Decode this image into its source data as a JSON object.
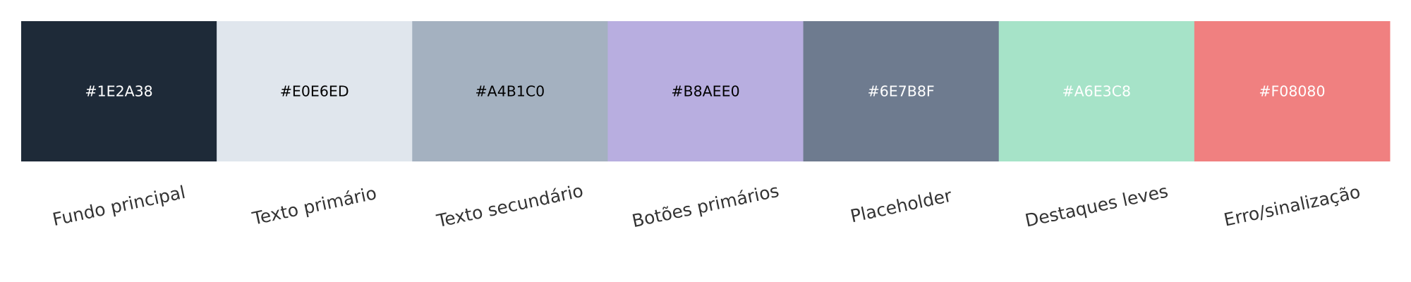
{
  "chart_data": {
    "type": "palette",
    "swatches": [
      {
        "hex": "#1E2A38",
        "label": "Fundo principal",
        "text_color": "#ffffff"
      },
      {
        "hex": "#E0E6ED",
        "label": "Texto primário",
        "text_color": "#000000"
      },
      {
        "hex": "#A4B1C0",
        "label": "Texto secundário",
        "text_color": "#000000"
      },
      {
        "hex": "#B8AEE0",
        "label": "Botões primários",
        "text_color": "#000000"
      },
      {
        "hex": "#6E7B8F",
        "label": "Placeholder",
        "text_color": "#ffffff"
      },
      {
        "hex": "#A6E3C8",
        "label": "Destaques leves",
        "text_color": "#ffffff"
      },
      {
        "hex": "#F08080",
        "label": "Erro/sinalização",
        "text_color": "#ffffff"
      }
    ],
    "label_rotation": "slanted upward"
  }
}
